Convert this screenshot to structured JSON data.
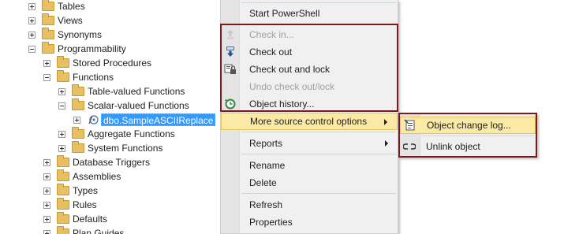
{
  "tree": {
    "nodes": [
      {
        "label": "Tables",
        "expander": "plus",
        "icon": "folder-icon"
      },
      {
        "label": "Views",
        "expander": "plus",
        "icon": "folder-icon"
      },
      {
        "label": "Synonyms",
        "expander": "plus",
        "icon": "folder-icon"
      },
      {
        "label": "Programmability",
        "expander": "minus",
        "icon": "folder-icon"
      },
      {
        "label": "Stored Procedures",
        "expander": "plus",
        "icon": "folder-icon"
      },
      {
        "label": "Functions",
        "expander": "minus",
        "icon": "folder-icon"
      },
      {
        "label": "Table-valued Functions",
        "expander": "plus",
        "icon": "folder-icon"
      },
      {
        "label": "Scalar-valued Functions",
        "expander": "minus",
        "icon": "folder-icon"
      },
      {
        "label": "dbo.SampleASCIIReplace",
        "expander": "plus",
        "icon": "scalar-function-icon",
        "selected": true
      },
      {
        "label": "Aggregate Functions",
        "expander": "plus",
        "icon": "folder-icon"
      },
      {
        "label": "System Functions",
        "expander": "plus",
        "icon": "folder-icon"
      },
      {
        "label": "Database Triggers",
        "expander": "plus",
        "icon": "folder-icon"
      },
      {
        "label": "Assemblies",
        "expander": "plus",
        "icon": "folder-icon"
      },
      {
        "label": "Types",
        "expander": "plus",
        "icon": "folder-icon"
      },
      {
        "label": "Rules",
        "expander": "plus",
        "icon": "folder-icon"
      },
      {
        "label": "Defaults",
        "expander": "plus",
        "icon": "folder-icon"
      },
      {
        "label": "Plan Guides",
        "expander": "plus",
        "icon": "folder-icon"
      }
    ]
  },
  "context_menu": {
    "items": [
      {
        "label": "Start PowerShell",
        "enabled": true
      },
      {
        "label": "Check in...",
        "enabled": false,
        "icon": "check-in-icon"
      },
      {
        "label": "Check out",
        "enabled": true,
        "icon": "check-out-icon"
      },
      {
        "label": "Check out and lock",
        "enabled": true,
        "icon": "check-out-lock-icon"
      },
      {
        "label": "Undo check out/lock",
        "enabled": false
      },
      {
        "label": "Object history...",
        "enabled": true,
        "icon": "history-icon"
      },
      {
        "label": "More source control options",
        "enabled": true,
        "submenu": true,
        "hovered": true
      },
      {
        "label": "Reports",
        "enabled": true,
        "submenu": true
      },
      {
        "label": "Rename",
        "enabled": true
      },
      {
        "label": "Delete",
        "enabled": true
      },
      {
        "label": "Refresh",
        "enabled": true
      },
      {
        "label": "Properties",
        "enabled": true
      }
    ]
  },
  "submenu": {
    "items": [
      {
        "label": "Object change log...",
        "icon": "change-log-icon",
        "hovered": true
      },
      {
        "label": "Unlink object",
        "icon": "unlink-icon"
      }
    ]
  },
  "colors": {
    "selection": "#3399ff",
    "menu_hover": "#fbe9a6",
    "highlight_border": "#7a1a1a",
    "folder": "#e8c064"
  }
}
